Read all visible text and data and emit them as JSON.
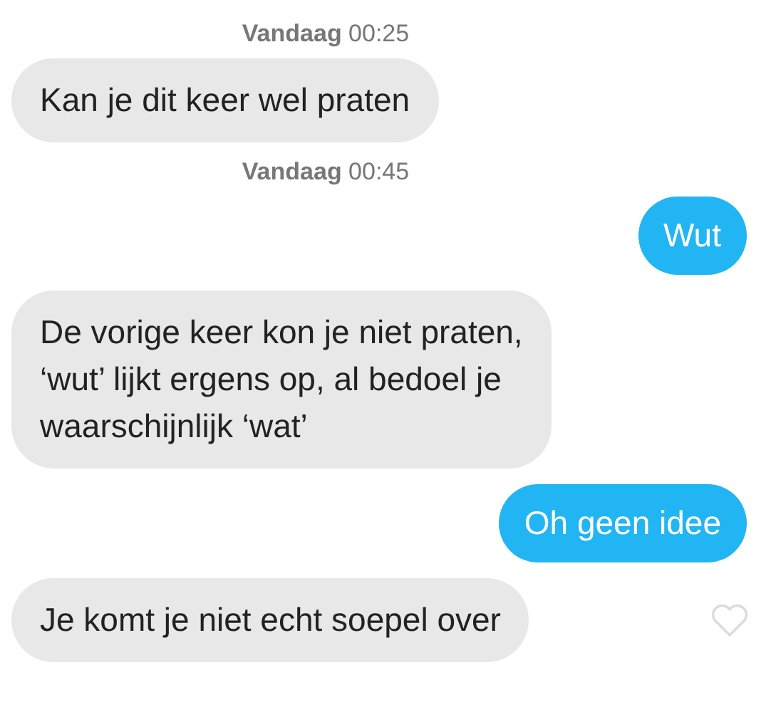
{
  "conversation": [
    {
      "kind": "timestamp",
      "text": "**Vandaag** 00:25"
    },
    {
      "kind": "received",
      "text": "Kan je dit keer wel praten"
    },
    {
      "kind": "timestamp",
      "text": "**Vandaag** 00:45"
    },
    {
      "kind": "sent",
      "text": "Wut"
    },
    {
      "kind": "received",
      "text": "De vorige keer kon je niet praten,\n‘wut’ lijkt ergens op, al bedoel je\nwaarschijnlijk ‘wat’"
    },
    {
      "kind": "sent",
      "text": "Oh geen idee"
    },
    {
      "kind": "received",
      "text": "Je komt je niet echt soepel over",
      "liked": false
    }
  ]
}
